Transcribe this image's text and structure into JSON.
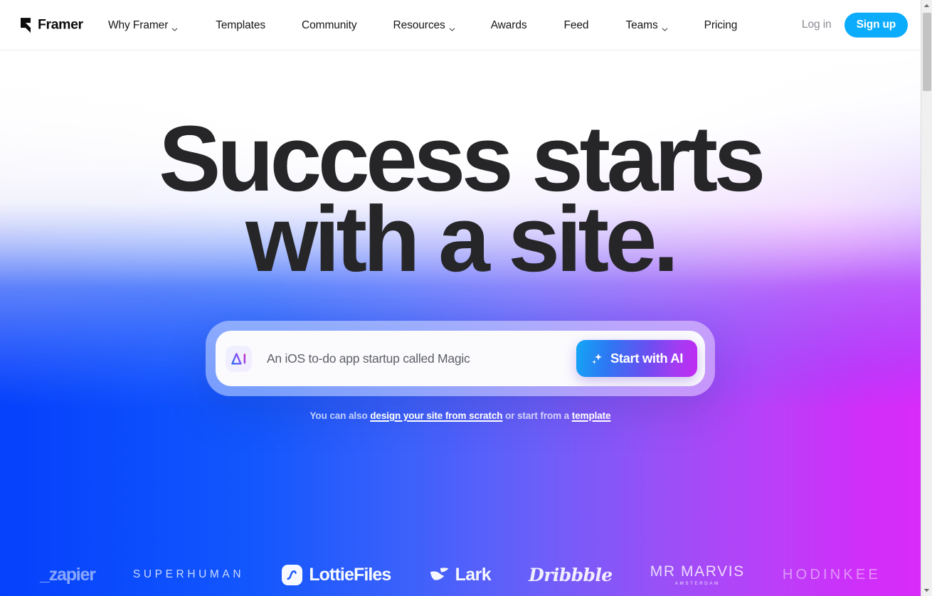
{
  "nav": {
    "brand": {
      "name": "Framer",
      "icon": "framer-logo-icon"
    },
    "links": [
      {
        "label": "Why Framer",
        "has_chevron": true
      },
      {
        "label": "Templates",
        "has_chevron": false
      },
      {
        "label": "Community",
        "has_chevron": false
      },
      {
        "label": "Resources",
        "has_chevron": true
      },
      {
        "label": "Awards",
        "has_chevron": false
      },
      {
        "label": "Feed",
        "has_chevron": false
      },
      {
        "label": "Teams",
        "has_chevron": true
      },
      {
        "label": "Pricing",
        "has_chevron": false
      }
    ],
    "login_label": "Log in",
    "signup_label": "Sign up",
    "signup_color": "#0bacfc"
  },
  "hero": {
    "headline_line1": "Success starts",
    "headline_line2": "with a site.",
    "headline_color": "#262629",
    "prompt": {
      "badge_icon": "ai-badge-icon",
      "badge_text": "AI",
      "placeholder": "An iOS to-do app startup called Magic",
      "value": "",
      "button_label": "Start with AI",
      "button_icon": "sparkle-icon"
    },
    "subline": {
      "prefix": "You can also ",
      "link1": "design your site from scratch",
      "middle": " or start from a ",
      "link2": "template"
    }
  },
  "logos": [
    {
      "name": "zapier",
      "text": "_zapier",
      "sub": ""
    },
    {
      "name": "superhuman",
      "text": "SUPERHUMAN",
      "sub": ""
    },
    {
      "name": "lottiefiles",
      "text": "LottieFiles",
      "sub": ""
    },
    {
      "name": "lark",
      "text": "Lark",
      "sub": ""
    },
    {
      "name": "dribbble",
      "text": "Dribbble",
      "sub": ""
    },
    {
      "name": "mr-marvis",
      "text": "MR MARVIS",
      "sub": "AMSTERDAM"
    },
    {
      "name": "hodinkee",
      "text": "HODINKEE",
      "sub": ""
    }
  ],
  "colors": {
    "gradient_start": "#0540fb",
    "gradient_end": "#d92bfa",
    "accent_blue": "#0bacfc"
  }
}
